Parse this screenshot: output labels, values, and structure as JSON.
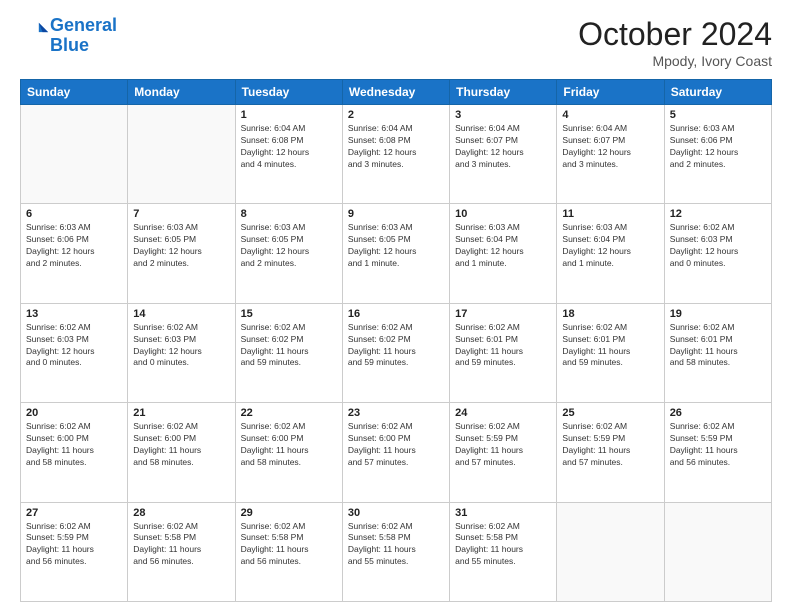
{
  "header": {
    "logo_line1": "General",
    "logo_line2": "Blue",
    "month": "October 2024",
    "location": "Mpody, Ivory Coast"
  },
  "weekdays": [
    "Sunday",
    "Monday",
    "Tuesday",
    "Wednesday",
    "Thursday",
    "Friday",
    "Saturday"
  ],
  "weeks": [
    [
      {
        "day": "",
        "info": ""
      },
      {
        "day": "",
        "info": ""
      },
      {
        "day": "1",
        "info": "Sunrise: 6:04 AM\nSunset: 6:08 PM\nDaylight: 12 hours\nand 4 minutes."
      },
      {
        "day": "2",
        "info": "Sunrise: 6:04 AM\nSunset: 6:08 PM\nDaylight: 12 hours\nand 3 minutes."
      },
      {
        "day": "3",
        "info": "Sunrise: 6:04 AM\nSunset: 6:07 PM\nDaylight: 12 hours\nand 3 minutes."
      },
      {
        "day": "4",
        "info": "Sunrise: 6:04 AM\nSunset: 6:07 PM\nDaylight: 12 hours\nand 3 minutes."
      },
      {
        "day": "5",
        "info": "Sunrise: 6:03 AM\nSunset: 6:06 PM\nDaylight: 12 hours\nand 2 minutes."
      }
    ],
    [
      {
        "day": "6",
        "info": "Sunrise: 6:03 AM\nSunset: 6:06 PM\nDaylight: 12 hours\nand 2 minutes."
      },
      {
        "day": "7",
        "info": "Sunrise: 6:03 AM\nSunset: 6:05 PM\nDaylight: 12 hours\nand 2 minutes."
      },
      {
        "day": "8",
        "info": "Sunrise: 6:03 AM\nSunset: 6:05 PM\nDaylight: 12 hours\nand 2 minutes."
      },
      {
        "day": "9",
        "info": "Sunrise: 6:03 AM\nSunset: 6:05 PM\nDaylight: 12 hours\nand 1 minute."
      },
      {
        "day": "10",
        "info": "Sunrise: 6:03 AM\nSunset: 6:04 PM\nDaylight: 12 hours\nand 1 minute."
      },
      {
        "day": "11",
        "info": "Sunrise: 6:03 AM\nSunset: 6:04 PM\nDaylight: 12 hours\nand 1 minute."
      },
      {
        "day": "12",
        "info": "Sunrise: 6:02 AM\nSunset: 6:03 PM\nDaylight: 12 hours\nand 0 minutes."
      }
    ],
    [
      {
        "day": "13",
        "info": "Sunrise: 6:02 AM\nSunset: 6:03 PM\nDaylight: 12 hours\nand 0 minutes."
      },
      {
        "day": "14",
        "info": "Sunrise: 6:02 AM\nSunset: 6:03 PM\nDaylight: 12 hours\nand 0 minutes."
      },
      {
        "day": "15",
        "info": "Sunrise: 6:02 AM\nSunset: 6:02 PM\nDaylight: 11 hours\nand 59 minutes."
      },
      {
        "day": "16",
        "info": "Sunrise: 6:02 AM\nSunset: 6:02 PM\nDaylight: 11 hours\nand 59 minutes."
      },
      {
        "day": "17",
        "info": "Sunrise: 6:02 AM\nSunset: 6:01 PM\nDaylight: 11 hours\nand 59 minutes."
      },
      {
        "day": "18",
        "info": "Sunrise: 6:02 AM\nSunset: 6:01 PM\nDaylight: 11 hours\nand 59 minutes."
      },
      {
        "day": "19",
        "info": "Sunrise: 6:02 AM\nSunset: 6:01 PM\nDaylight: 11 hours\nand 58 minutes."
      }
    ],
    [
      {
        "day": "20",
        "info": "Sunrise: 6:02 AM\nSunset: 6:00 PM\nDaylight: 11 hours\nand 58 minutes."
      },
      {
        "day": "21",
        "info": "Sunrise: 6:02 AM\nSunset: 6:00 PM\nDaylight: 11 hours\nand 58 minutes."
      },
      {
        "day": "22",
        "info": "Sunrise: 6:02 AM\nSunset: 6:00 PM\nDaylight: 11 hours\nand 58 minutes."
      },
      {
        "day": "23",
        "info": "Sunrise: 6:02 AM\nSunset: 6:00 PM\nDaylight: 11 hours\nand 57 minutes."
      },
      {
        "day": "24",
        "info": "Sunrise: 6:02 AM\nSunset: 5:59 PM\nDaylight: 11 hours\nand 57 minutes."
      },
      {
        "day": "25",
        "info": "Sunrise: 6:02 AM\nSunset: 5:59 PM\nDaylight: 11 hours\nand 57 minutes."
      },
      {
        "day": "26",
        "info": "Sunrise: 6:02 AM\nSunset: 5:59 PM\nDaylight: 11 hours\nand 56 minutes."
      }
    ],
    [
      {
        "day": "27",
        "info": "Sunrise: 6:02 AM\nSunset: 5:59 PM\nDaylight: 11 hours\nand 56 minutes."
      },
      {
        "day": "28",
        "info": "Sunrise: 6:02 AM\nSunset: 5:58 PM\nDaylight: 11 hours\nand 56 minutes."
      },
      {
        "day": "29",
        "info": "Sunrise: 6:02 AM\nSunset: 5:58 PM\nDaylight: 11 hours\nand 56 minutes."
      },
      {
        "day": "30",
        "info": "Sunrise: 6:02 AM\nSunset: 5:58 PM\nDaylight: 11 hours\nand 55 minutes."
      },
      {
        "day": "31",
        "info": "Sunrise: 6:02 AM\nSunset: 5:58 PM\nDaylight: 11 hours\nand 55 minutes."
      },
      {
        "day": "",
        "info": ""
      },
      {
        "day": "",
        "info": ""
      }
    ]
  ]
}
